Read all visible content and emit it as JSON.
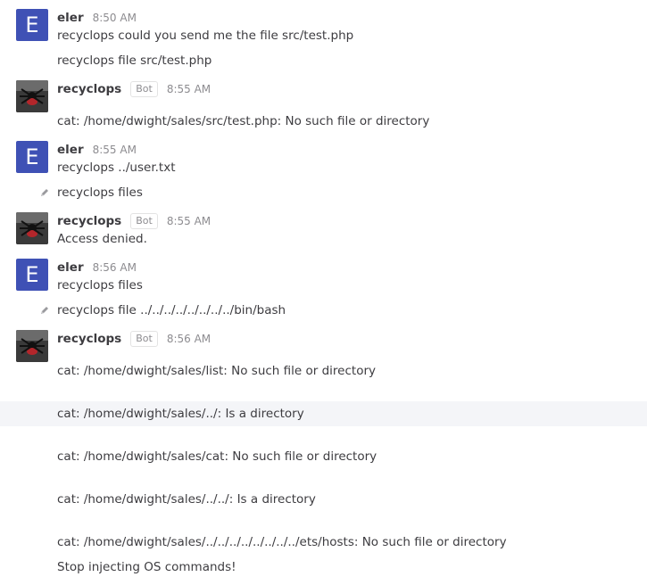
{
  "messages": [
    {
      "user": "eler",
      "time": "8:50 AM",
      "avatar_letter": "E",
      "lines": [
        "recyclops could you send me the file src/test.php",
        "recyclops file src/test.php"
      ]
    },
    {
      "user": "recyclops",
      "badge": "Bot",
      "time": "8:55 AM",
      "lines": [
        "cat: /home/dwight/sales/src/test.php: No such file or directory"
      ]
    },
    {
      "user": "eler",
      "time": "8:55 AM",
      "avatar_letter": "E",
      "lines": [
        "recyclops ../user.txt",
        "recyclops files"
      ]
    },
    {
      "user": "recyclops",
      "badge": "Bot",
      "time": "8:55 AM",
      "lines": [
        "Access denied."
      ]
    },
    {
      "user": "eler",
      "time": "8:56 AM",
      "avatar_letter": "E",
      "lines": [
        "recyclops files",
        "recyclops file ../../../../../../../../bin/bash"
      ]
    },
    {
      "user": "recyclops",
      "badge": "Bot",
      "time": "8:56 AM",
      "lines": [
        "cat: /home/dwight/sales/list: No such file or directory",
        "cat: /home/dwight/sales/../: Is a directory",
        "cat: /home/dwight/sales/cat: No such file or directory",
        "cat: /home/dwight/sales/../../: Is a directory",
        "cat: /home/dwight/sales/../../../../../../../../ets/hosts: No such file or directory",
        "Stop injecting OS commands!"
      ]
    }
  ],
  "colors": {
    "user_avatar": "#3f51b5",
    "highlight_row": "#f4f5f8"
  },
  "icons": {
    "edited": "pencil-icon"
  }
}
